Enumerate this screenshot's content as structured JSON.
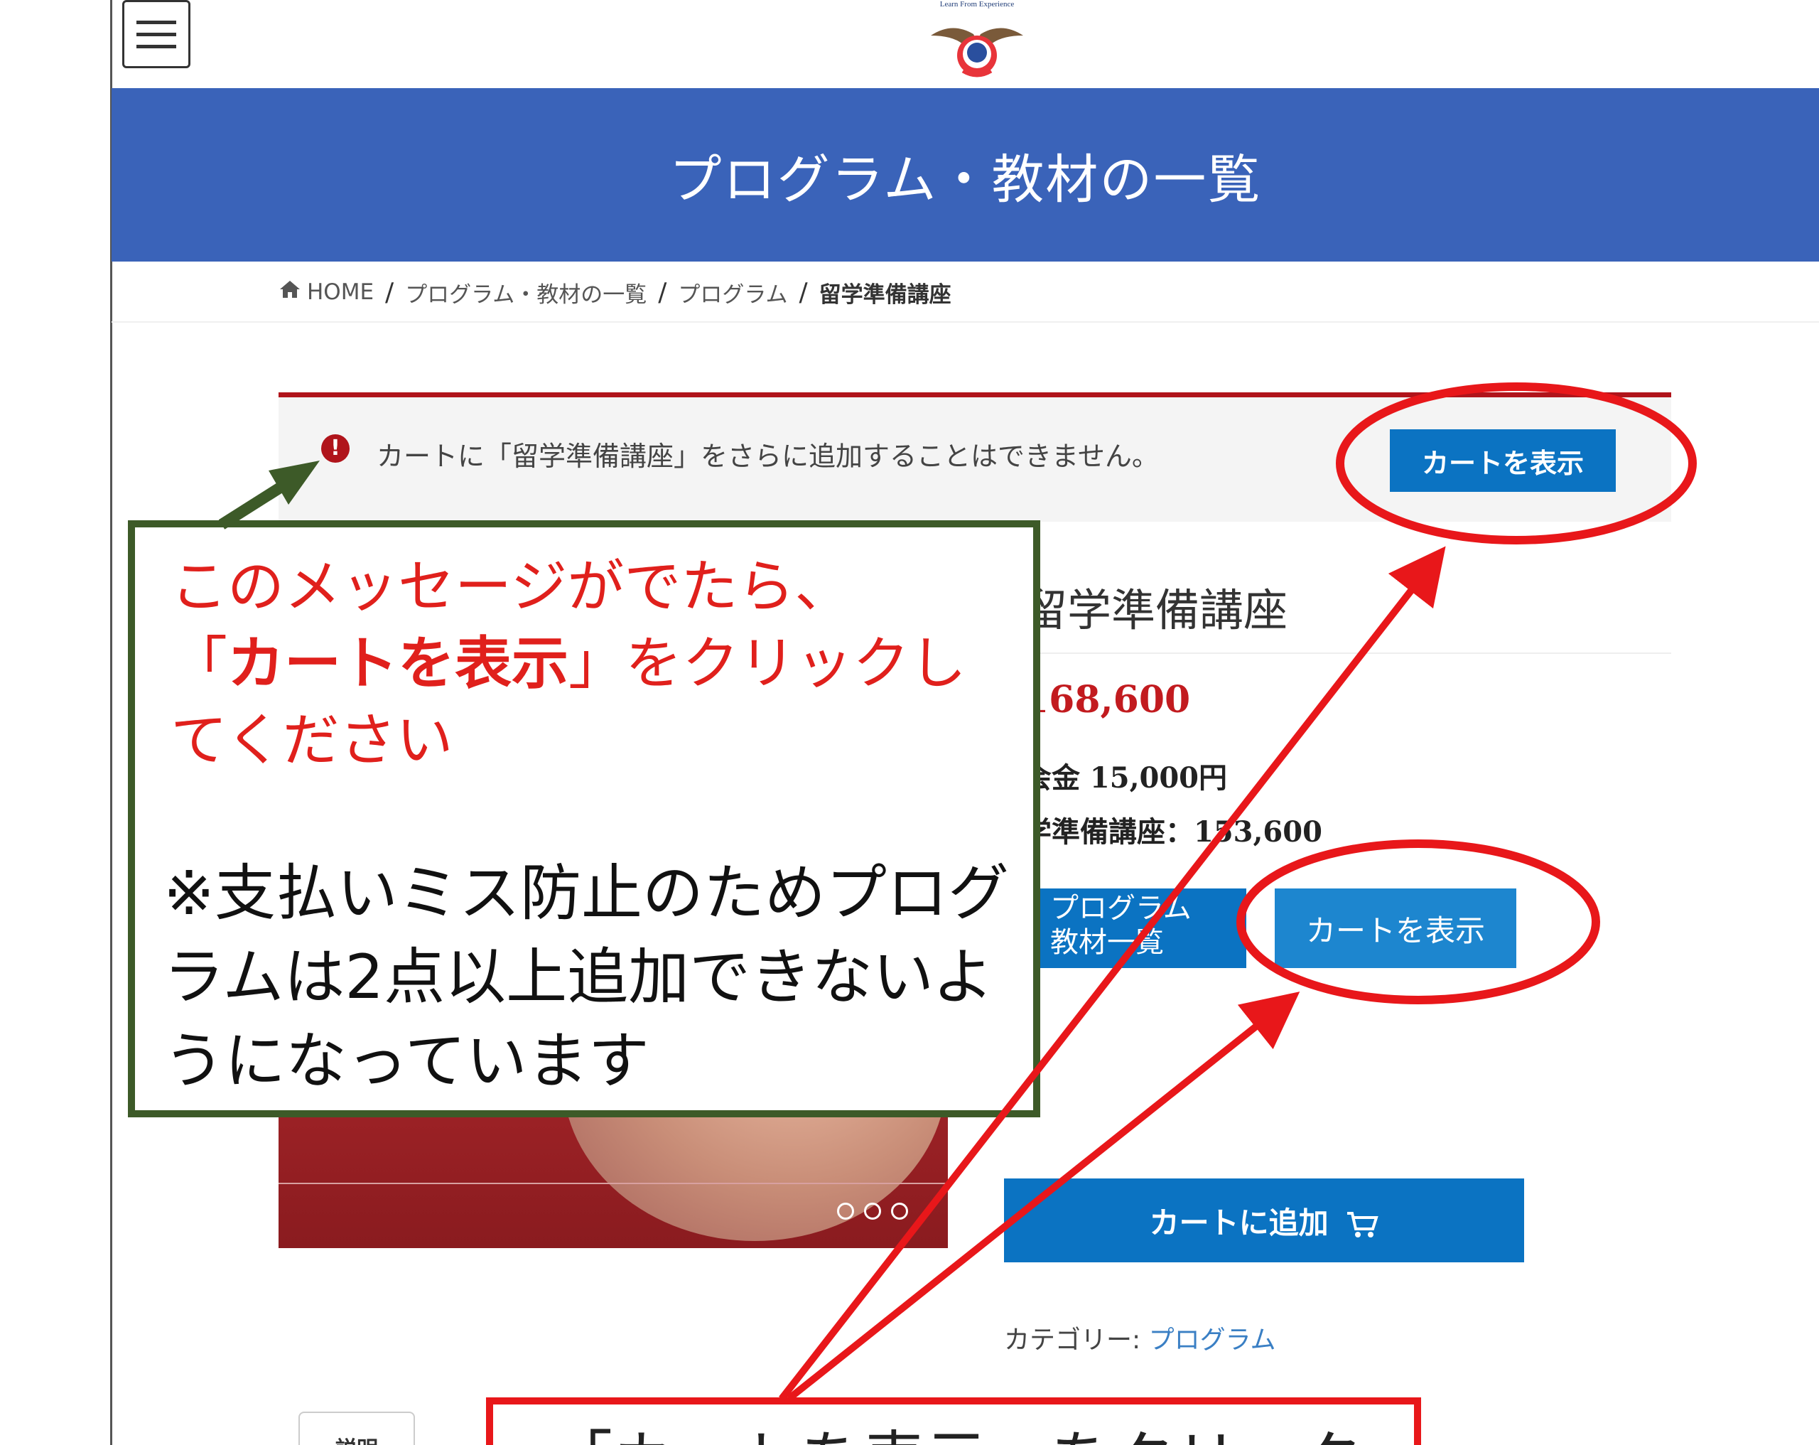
{
  "header": {
    "logo_text": "Learn From Experience",
    "banner_title": "プログラム・教材の一覧"
  },
  "breadcrumb": {
    "home": "HOME",
    "items": [
      "プログラム・教材の一覧",
      "プログラム"
    ],
    "current": "留学準備講座"
  },
  "notice": {
    "icon": "!",
    "message": "カートに「留学準備講座」をさらに追加することはできません。",
    "button_label": "カートを表示"
  },
  "product": {
    "title": "留学準備講座",
    "price": "168,600",
    "lines": [
      "会金 15,000円",
      "学準備講座：153,600"
    ],
    "programs_button": [
      "プログラム",
      "教材一覧"
    ],
    "view_cart_button": "カートを表示",
    "add_to_cart_button": "カートに追加",
    "category_label": "カテゴリー:",
    "category_link": "プログラム",
    "tab_description": "説明"
  },
  "annotation": {
    "red_prefix": "このメッセージがでたら、",
    "red_open_quote": "「",
    "red_bold": "カートを表示",
    "red_suffix": "」をクリックしてください",
    "note": "※支払いミス防止のためプログラムは2点以上追加できないようになっています",
    "bottom": "「カートを表示」をクリック"
  },
  "colors": {
    "banner": "#3a63b9",
    "button": "#0b73c2",
    "alert": "#b0141b",
    "annotation_red": "#e8171a",
    "annotation_green": "#3d5a28"
  }
}
